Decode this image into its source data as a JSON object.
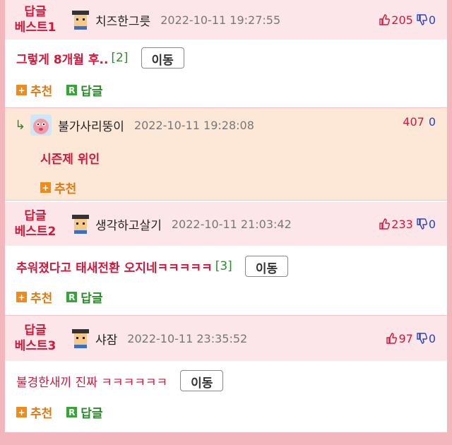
{
  "best1": {
    "label": "답글\n베스트1",
    "nick": "치즈한그릇",
    "date": "2022-10-11 19:27:55",
    "up": "205",
    "down": "0",
    "text": "그렇게 8개월 후..",
    "reply_count": "[2]",
    "move": "이동",
    "recommend": "추천",
    "reply": "답글"
  },
  "reply1": {
    "nick": "불가사리뚱이",
    "date": "2022-10-11 19:28:08",
    "up": "407",
    "down": "0",
    "text": "시즌제 위인",
    "recommend": "추천"
  },
  "best2": {
    "label": "답글\n베스트2",
    "nick": "생각하고살기",
    "date": "2022-10-11 21:03:42",
    "up": "233",
    "down": "0",
    "text": "추워졌다고 태새전환 오지네ㅋㅋㅋㅋㅋ",
    "reply_count": "[3]",
    "move": "이동",
    "recommend": "추천",
    "reply": "답글"
  },
  "best3": {
    "label": "답글\n베스트3",
    "nick": "샤잠",
    "date": "2022-10-11 23:35:52",
    "up": "97",
    "down": "0",
    "text": "불경한새끼 진짜 ㅋㅋㅋㅋㅋㅋ",
    "move": "이동",
    "recommend": "추천",
    "reply": "답글"
  },
  "colors": {
    "accent": "#d2183b",
    "header_bg": "#fde6ea",
    "reply_bg": "#fde8d8",
    "frame": "#f3b6bd"
  },
  "icons": [
    "thumbs-up-icon",
    "thumbs-down-icon",
    "avatar-pixel-icon",
    "avatar-pink-icon",
    "plus-icon",
    "reply-badge-icon",
    "reply-arrow-icon"
  ]
}
